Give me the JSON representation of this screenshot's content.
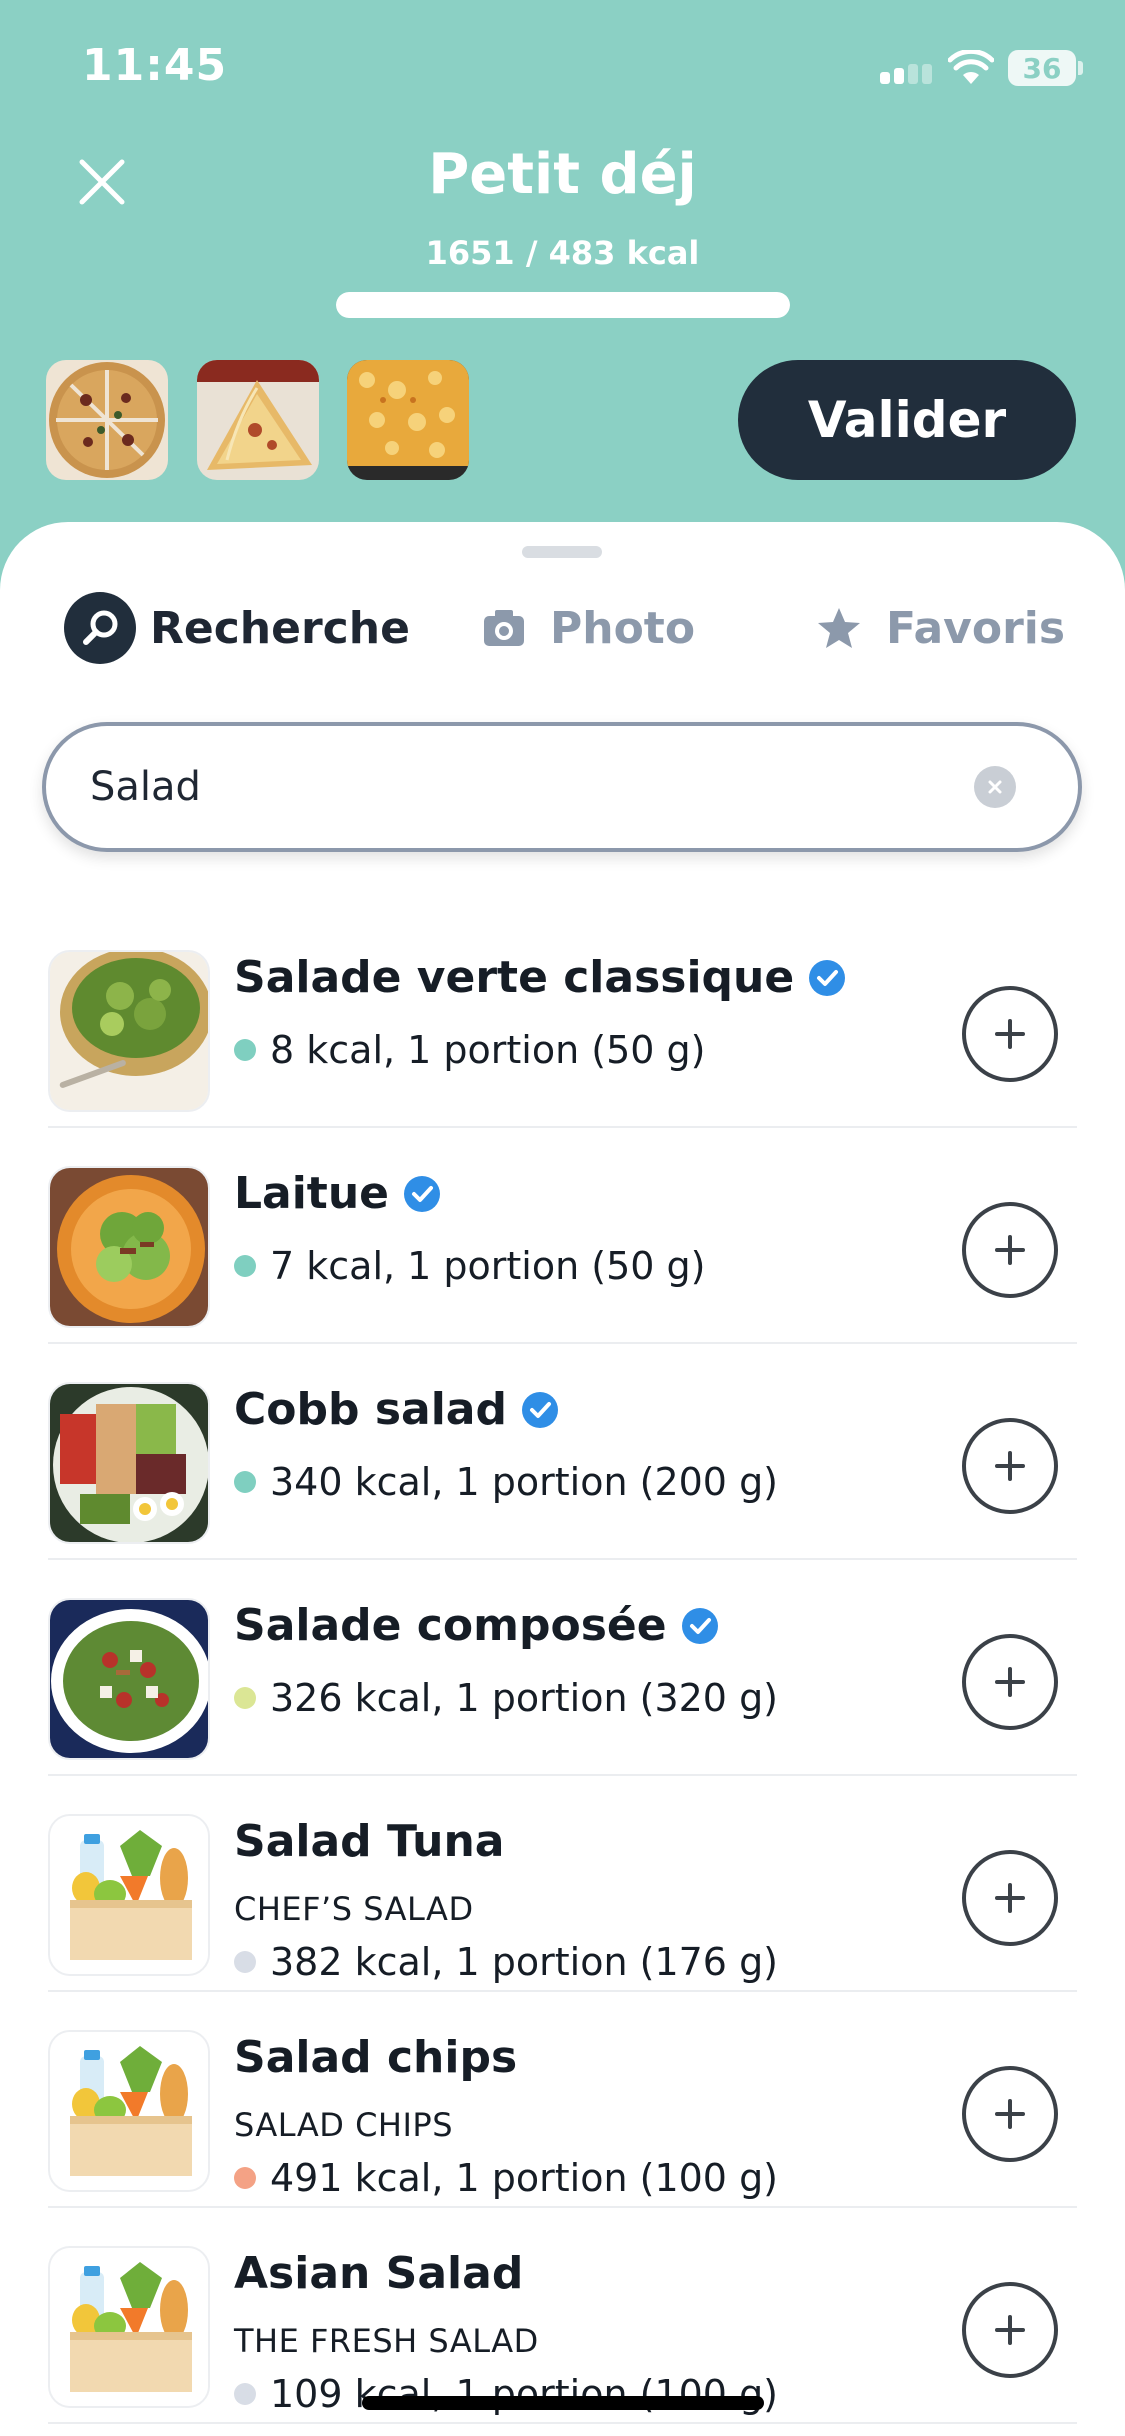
{
  "status_bar": {
    "time": "11:45",
    "battery": "36"
  },
  "header": {
    "title": "Petit déj",
    "kcal_summary": "1651 / 483 kcal",
    "progress_fraction": 1.0
  },
  "actions": {
    "validate_label": "Valider"
  },
  "tabs": [
    {
      "label": "Recherche",
      "icon": "search-icon",
      "active": true
    },
    {
      "label": "Photo",
      "icon": "camera-icon",
      "active": false
    },
    {
      "label": "Favoris",
      "icon": "star-icon",
      "active": false
    }
  ],
  "search": {
    "value": "Salad"
  },
  "results": [
    {
      "name": "Salade verte classique",
      "verified": true,
      "brand": "",
      "meta": "8 kcal, 1 portion (50 g)",
      "dot_color": "#7fcfc0",
      "image": "green-salad-bowl"
    },
    {
      "name": "Laitue",
      "verified": true,
      "brand": "",
      "meta": "7 kcal, 1 portion (50 g)",
      "dot_color": "#7fcfc0",
      "image": "lettuce-plate"
    },
    {
      "name": "Cobb salad",
      "verified": true,
      "brand": "",
      "meta": "340 kcal, 1 portion (200 g)",
      "dot_color": "#7fcfc0",
      "image": "cobb-salad"
    },
    {
      "name": "Salade composée",
      "verified": true,
      "brand": "",
      "meta": "326 kcal, 1 portion (320 g)",
      "dot_color": "#dbe695",
      "image": "mixed-salad"
    },
    {
      "name": "Salad Tuna",
      "verified": false,
      "brand": "CHEF’S SALAD",
      "meta": "382 kcal, 1 portion (176 g)",
      "dot_color": "#d8dde6",
      "image": "grocery-bag-icon"
    },
    {
      "name": "Salad chips",
      "verified": false,
      "brand": "SALAD CHIPS",
      "meta": "491 kcal, 1 portion (100 g)",
      "dot_color": "#f4a285",
      "image": "grocery-bag-icon"
    },
    {
      "name": "Asian Salad",
      "verified": false,
      "brand": "THE FRESH SALAD",
      "meta": "109 kcal, 1 portion (100 g)",
      "dot_color": "#d8dde6",
      "image": "grocery-bag-icon"
    }
  ]
}
